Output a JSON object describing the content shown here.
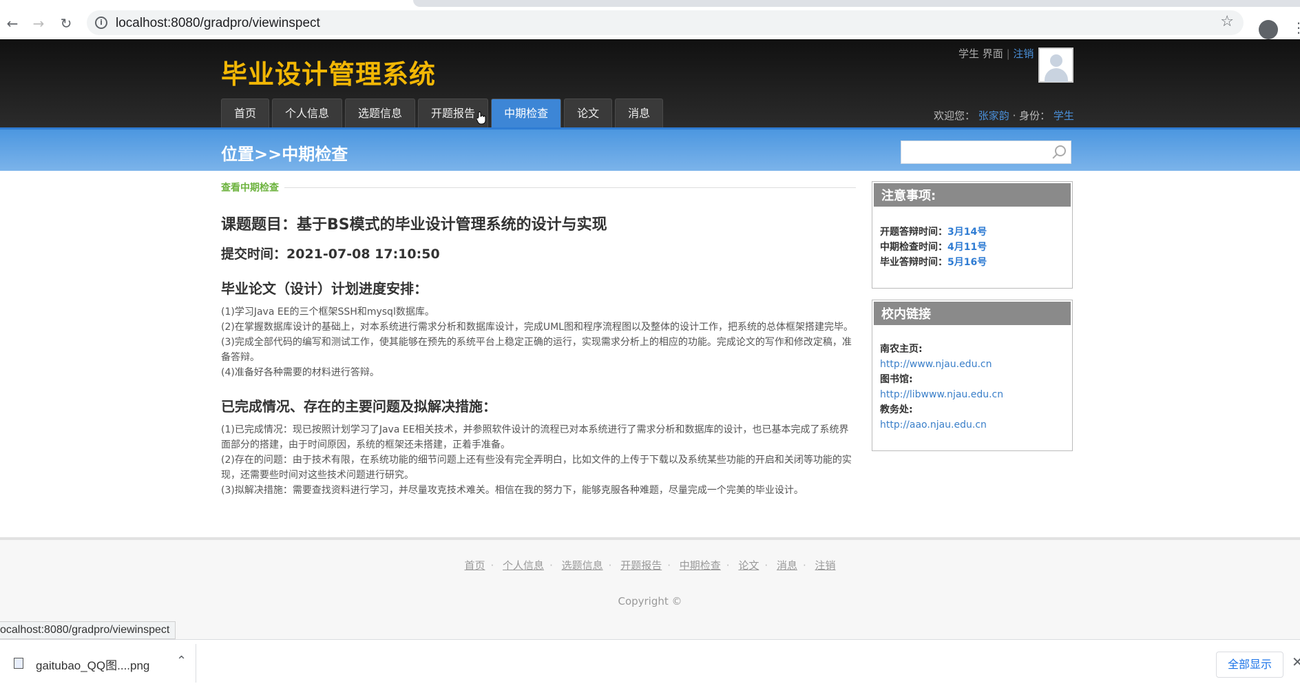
{
  "browser": {
    "url": "localhost:8080/gradpro/viewinspect",
    "status_url": "ocalhost:8080/gradpro/viewinspect"
  },
  "header": {
    "logo": "毕业设计管理系统",
    "role_label": "学生 界面",
    "separator": "|",
    "logout": "注销",
    "welcome_label": "欢迎您：",
    "user_name": "张家韵",
    "identity_sep": "· 身份：",
    "identity": "学生"
  },
  "nav": [
    {
      "label": "首页",
      "active": false
    },
    {
      "label": "个人信息",
      "active": false
    },
    {
      "label": "选题信息",
      "active": false
    },
    {
      "label": "开题报告",
      "active": false
    },
    {
      "label": "中期检查",
      "active": true
    },
    {
      "label": "论文",
      "active": false
    },
    {
      "label": "消息",
      "active": false
    }
  ],
  "breadcrumb": "位置>>中期检查",
  "search": {
    "placeholder": ""
  },
  "main": {
    "section_label": "查看中期检查",
    "topic": "课题题目：基于BS模式的毕业设计管理系统的设计与实现",
    "submit_time": "提交时间：2021-07-08 17:10:50",
    "plan_heading": "毕业论文（设计）计划进度安排：",
    "plan_items": [
      "(1)学习Java EE的三个框架SSH和mysql数据库。",
      "(2)在掌握数据库设计的基础上，对本系统进行需求分析和数据库设计，完成UML图和程序流程图以及整体的设计工作，把系统的总体框架搭建完毕。",
      "(3)完成全部代码的编写和测试工作，使其能够在预先的系统平台上稳定正确的运行，实现需求分析上的相应的功能。完成论文的写作和修改定稿，准备答辩。",
      "(4)准备好各种需要的材料进行答辩。"
    ],
    "issues_heading": "已完成情况、存在的主要问题及拟解决措施：",
    "issues_items": [
      "(1)已完成情况：现已按照计划学习了Java EE相关技术，并参照软件设计的流程已对本系统进行了需求分析和数据库的设计，也已基本完成了系统界面部分的搭建，由于时间原因，系统的框架还未搭建，正着手准备。",
      "(2)存在的问题：由于技术有限，在系统功能的细节问题上还有些没有完全弄明白，比如文件的上传于下载以及系统某些功能的开启和关闭等功能的实现，还需要些时间对这些技术问题进行研究。",
      "(3)拟解决措施：需要查找资料进行学习，并尽量攻克技术难关。相信在我的努力下，能够克服各种难题，尽量完成一个完美的毕业设计。"
    ]
  },
  "sidebar": {
    "notice_title": "注意事项:",
    "notices": [
      {
        "label": "开题答辩时间：",
        "value": "3月14号"
      },
      {
        "label": "中期检查时间：",
        "value": "4月11号"
      },
      {
        "label": "毕业答辩时间：",
        "value": "5月16号"
      }
    ],
    "links_title": "校内链接",
    "links": [
      {
        "label": "南农主页:",
        "url": "http://www.njau.edu.cn"
      },
      {
        "label": "图书馆:",
        "url": "http://libwww.njau.edu.cn"
      },
      {
        "label": "教务处:",
        "url": "http://aao.njau.edu.cn"
      }
    ]
  },
  "footer": {
    "links": [
      "首页",
      "个人信息",
      "选题信息",
      "开题报告",
      "中期检查",
      "论文",
      "消息",
      "注销"
    ],
    "copyright": "Copyright ©"
  },
  "downloads": {
    "file_name": "gaitubao_QQ图....png",
    "show_all": "全部显示"
  }
}
